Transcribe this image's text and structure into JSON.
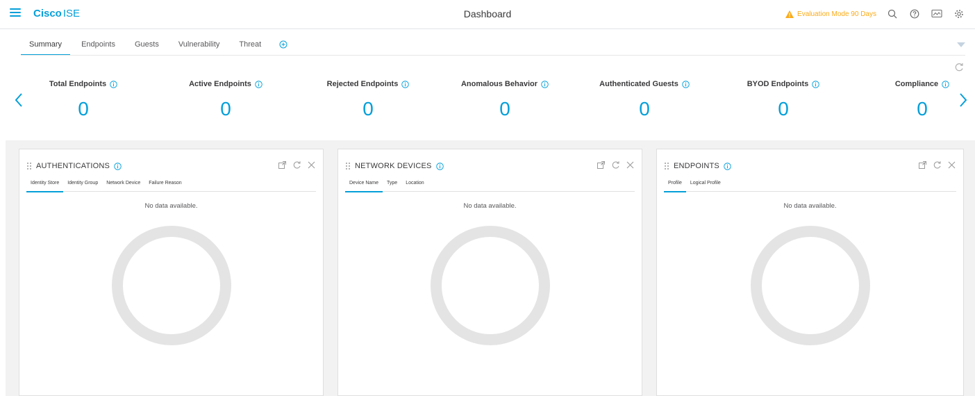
{
  "header": {
    "brand_bold": "Cisco",
    "brand_product": "ISE",
    "page_title": "Dashboard",
    "eval_text": "Evaluation Mode 90 Days",
    "icons": [
      "search-icon",
      "help-icon",
      "notifications-icon",
      "settings-icon"
    ],
    "accent_color": "#049fd9",
    "warning_color": "#fbab18"
  },
  "tabs": {
    "items": [
      {
        "label": "Summary",
        "active": true
      },
      {
        "label": "Endpoints",
        "active": false
      },
      {
        "label": "Guests",
        "active": false
      },
      {
        "label": "Vulnerability",
        "active": false
      },
      {
        "label": "Threat",
        "active": false
      }
    ]
  },
  "kpis": [
    {
      "label": "Total Endpoints",
      "value": "0"
    },
    {
      "label": "Active Endpoints",
      "value": "0"
    },
    {
      "label": "Rejected Endpoints",
      "value": "0"
    },
    {
      "label": "Anomalous Behavior",
      "value": "0"
    },
    {
      "label": "Authenticated Guests",
      "value": "0"
    },
    {
      "label": "BYOD Endpoints",
      "value": "0"
    },
    {
      "label": "Compliance",
      "value": "0"
    }
  ],
  "dashlets": [
    {
      "title": "AUTHENTICATIONS",
      "subtabs": [
        "Identity Store",
        "Identity Group",
        "Network Device",
        "Failure Reason"
      ],
      "empty_text": "No data available."
    },
    {
      "title": "NETWORK DEVICES",
      "subtabs": [
        "Device Name",
        "Type",
        "Location"
      ],
      "empty_text": "No data available."
    },
    {
      "title": "ENDPOINTS",
      "subtabs": [
        "Profile",
        "Logical Profile"
      ],
      "empty_text": "No data available."
    }
  ]
}
